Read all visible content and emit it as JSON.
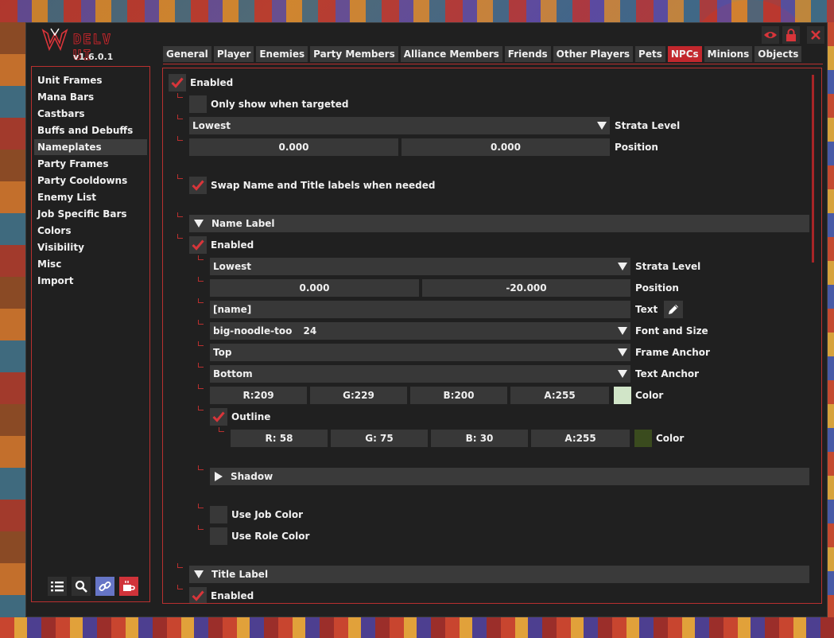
{
  "app": {
    "logo_text": "DELV UI",
    "version": "v1.6.0.1"
  },
  "window_buttons": [
    "eye-icon",
    "lock-icon",
    "close-icon"
  ],
  "sidebar": {
    "items": [
      "Unit Frames",
      "Mana Bars",
      "Castbars",
      "Buffs and Debuffs",
      "Nameplates",
      "Party Frames",
      "Party Cooldowns",
      "Enemy List",
      "Job Specific Bars",
      "Colors",
      "Visibility",
      "Misc",
      "Import"
    ],
    "selected": "Nameplates",
    "tools": [
      "list-icon",
      "search-icon",
      "link-icon",
      "coffee-icon"
    ]
  },
  "tabs": {
    "items": [
      "General",
      "Player",
      "Enemies",
      "Party Members",
      "Alliance Members",
      "Friends",
      "Other Players",
      "Pets",
      "NPCs",
      "Minions",
      "Objects"
    ],
    "active": "NPCs"
  },
  "colors": {
    "accent": "#c2272d",
    "panel": "#202020",
    "field": "#383838"
  },
  "content": {
    "enabled": {
      "label": "Enabled",
      "checked": true
    },
    "only_targeted": {
      "label": "Only show when targeted",
      "checked": false
    },
    "strata": {
      "value": "Lowest",
      "label": "Strata Level"
    },
    "position": {
      "x": "0.000",
      "y": "0.000",
      "label": "Position"
    },
    "swap_labels": {
      "label": "Swap Name and Title labels when needed",
      "checked": true
    },
    "name_label": {
      "title": "Name Label",
      "expanded": true,
      "enabled": {
        "label": "Enabled",
        "checked": true
      },
      "strata": {
        "value": "Lowest",
        "label": "Strata Level"
      },
      "position": {
        "x": "0.000",
        "y": "-20.000",
        "label": "Position"
      },
      "text": {
        "value": "[name]",
        "label": "Text"
      },
      "font": {
        "name": "big-noodle-too",
        "size": "24",
        "label": "Font and Size"
      },
      "frame_anchor": {
        "value": "Top",
        "label": "Frame Anchor"
      },
      "text_anchor": {
        "value": "Bottom",
        "label": "Text Anchor"
      },
      "color": {
        "r": "R:209",
        "g": "G:229",
        "b": "B:200",
        "a": "A:255",
        "label": "Color",
        "hex": "#d1e5c8"
      },
      "outline": {
        "label": "Outline",
        "checked": true,
        "color": {
          "r": "R: 58",
          "g": "G: 75",
          "b": "B: 30",
          "a": "A:255",
          "label": "Color",
          "hex": "#3a4b1e"
        }
      },
      "shadow": {
        "title": "Shadow",
        "expanded": false
      },
      "use_job_color": {
        "label": "Use Job Color",
        "checked": false
      },
      "use_role_color": {
        "label": "Use Role Color",
        "checked": false
      }
    },
    "title_label": {
      "title": "Title Label",
      "expanded": true,
      "enabled": {
        "label": "Enabled",
        "checked": true
      }
    }
  }
}
